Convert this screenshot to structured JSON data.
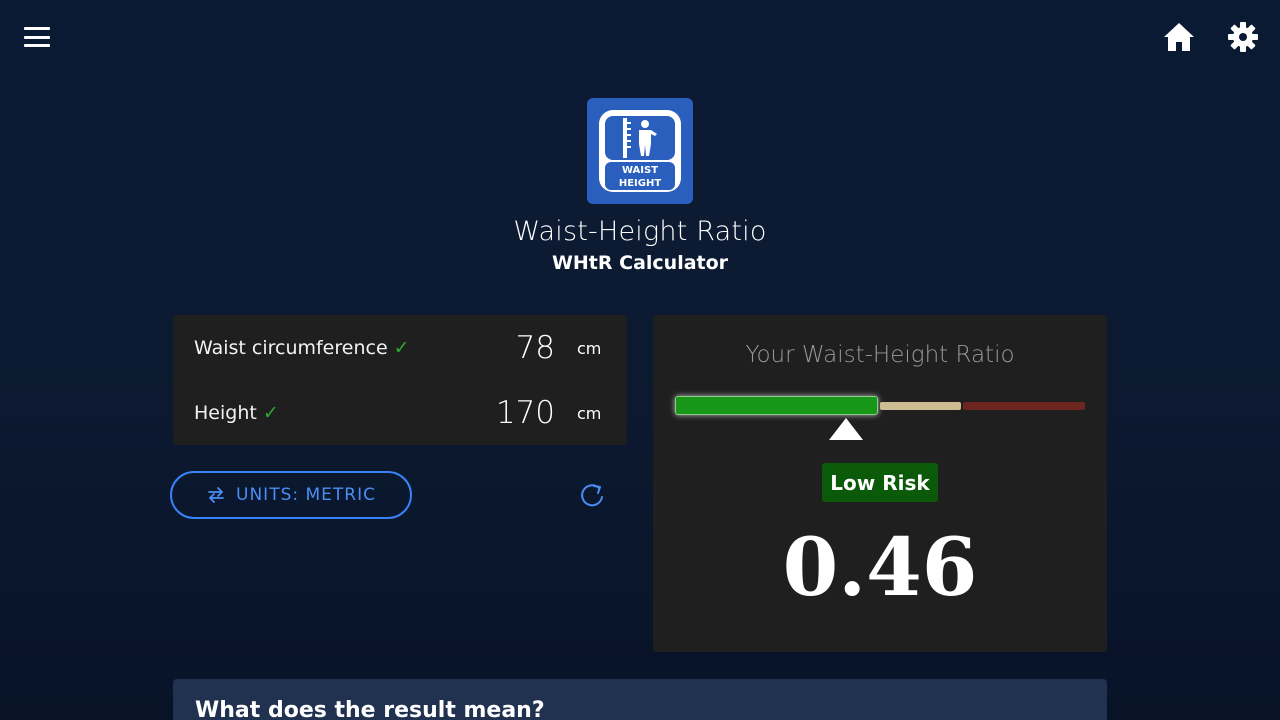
{
  "header": {
    "menu_icon": "hamburger-menu-icon",
    "home_icon": "home-icon",
    "settings_icon": "gear-icon"
  },
  "app": {
    "logo_text_line1": "WAIST",
    "logo_text_line2": "HEIGHT",
    "title": "Waist-Height Ratio",
    "subtitle": "WHtR Calculator"
  },
  "inputs": {
    "waist": {
      "label": "Waist circumference",
      "check": "✓",
      "value": "78",
      "unit": "cm"
    },
    "height": {
      "label": "Height",
      "check": "✓",
      "value": "170",
      "unit": "cm"
    }
  },
  "controls": {
    "units_label": "UNITS: METRIC",
    "units_icon": "swap-arrows-icon",
    "refresh_icon": "refresh-icon"
  },
  "result": {
    "title": "Your Waist-Height Ratio",
    "risk_label": "Low Risk",
    "ratio": "0.46",
    "colors": {
      "low": "#179617",
      "moderate": "#cdbb94",
      "high": "#6d2520",
      "badge": "#0a5a0a"
    }
  },
  "info": {
    "title": "What does the result mean?"
  },
  "colors": {
    "background": "#0b1a33",
    "card": "#1f1f1f",
    "accent": "#3b82f6",
    "check": "#2ea82e"
  }
}
